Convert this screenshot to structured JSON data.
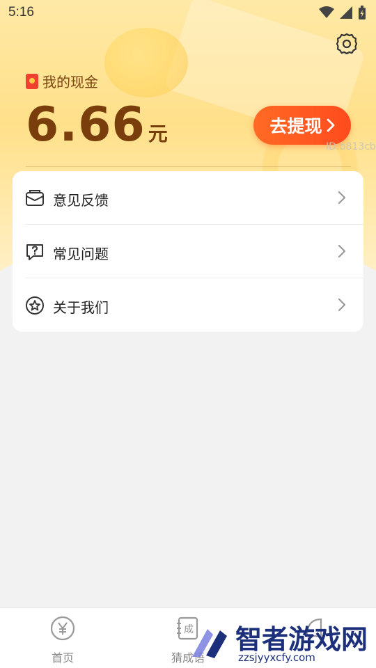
{
  "status_bar": {
    "time": "5:16"
  },
  "header": {
    "cash_label": "我的现金",
    "amount": "6.66",
    "unit": "元",
    "withdraw_label": "去提现",
    "user_id": "ID:b813cb"
  },
  "menu": {
    "items": [
      {
        "label": "意见反馈",
        "icon": "feedback-mail-icon"
      },
      {
        "label": "常见问题",
        "icon": "question-chat-icon"
      },
      {
        "label": "关于我们",
        "icon": "star-circle-icon"
      }
    ]
  },
  "tabbar": {
    "tabs": [
      {
        "label": "首页",
        "icon": "yen-coin-icon"
      },
      {
        "label": "猜成语",
        "icon": "idiom-book-icon"
      },
      {
        "label": "",
        "icon": "profile-icon"
      }
    ]
  },
  "watermark": {
    "text": "智者游戏网",
    "url": "zzsjyyxcfy.com"
  },
  "colors": {
    "accent": "#ff5a22",
    "amount_text": "#7a3d0c",
    "hero_bg": "#ffe08a"
  }
}
